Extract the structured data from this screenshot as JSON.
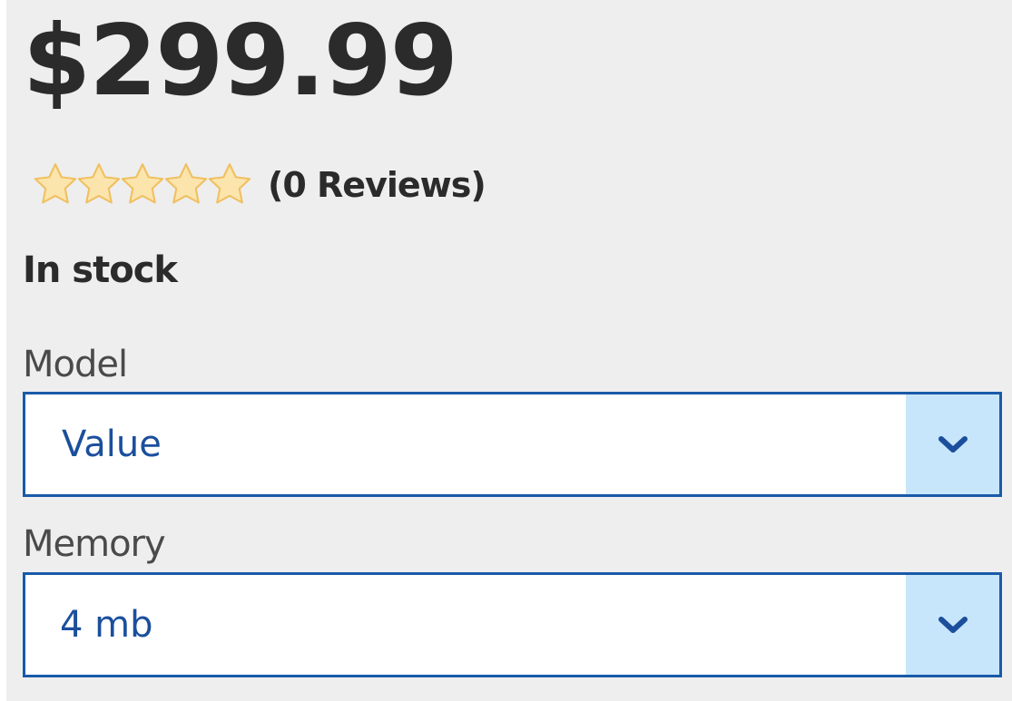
{
  "product": {
    "price": "$299.99",
    "rating": {
      "stars_filled": 0,
      "stars_total": 5,
      "reviews_label": "(0 Reviews)",
      "star_color": "#f4c96a"
    },
    "stock_status": "In stock"
  },
  "options": {
    "model": {
      "label": "Model",
      "selected": "Value",
      "icon": "chevron-down-icon"
    },
    "memory": {
      "label": "Memory",
      "selected": "4 mb",
      "icon": "chevron-down-icon"
    }
  },
  "colors": {
    "panel_background": "#eeeeee",
    "select_border": "#1a5aa8",
    "select_text": "#1b4f9c",
    "arrow_background": "#c8e6fb",
    "price_text": "#2b2b2b"
  }
}
